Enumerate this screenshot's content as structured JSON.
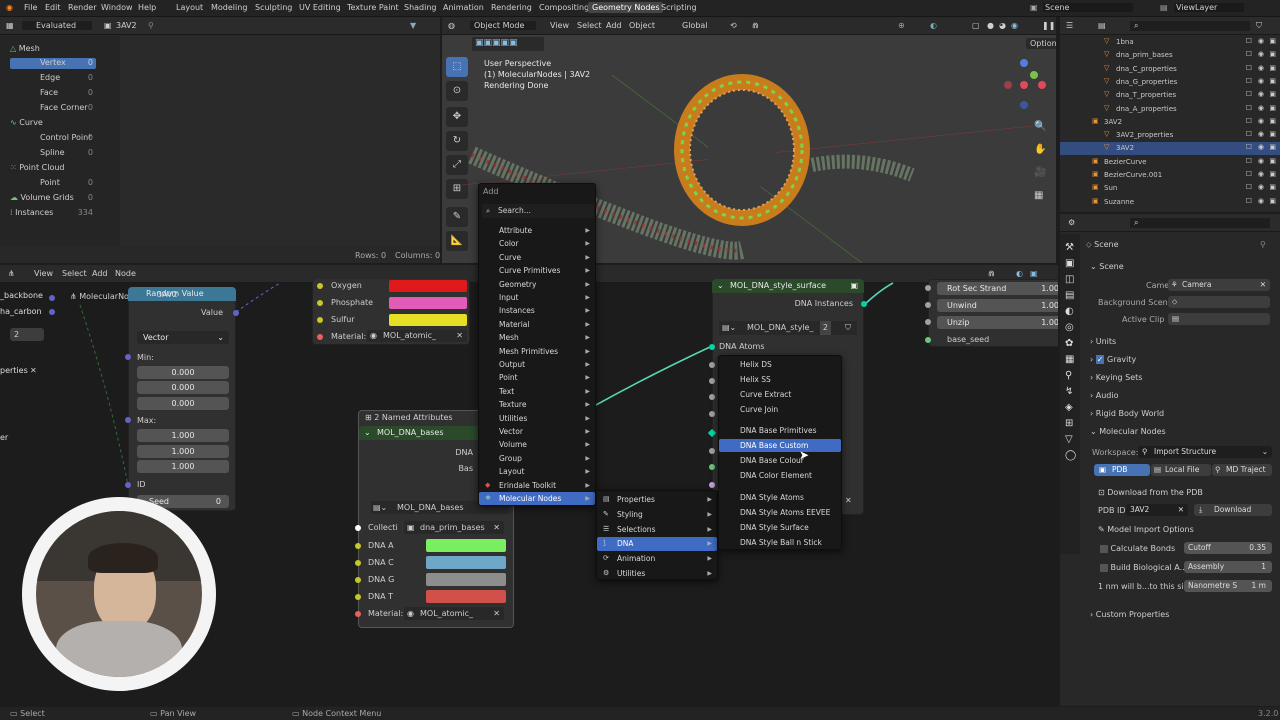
{
  "app_menu": [
    "File",
    "Edit",
    "Render",
    "Window",
    "Help"
  ],
  "workspaces": [
    "Layout",
    "Modeling",
    "Sculpting",
    "UV Editing",
    "Texture Paint",
    "Shading",
    "Animation",
    "Rendering",
    "Compositing",
    "Geometry Nodes",
    "Scripting"
  ],
  "active_workspace": "Geometry Nodes",
  "scene_name": "Scene",
  "viewlayer_name": "ViewLayer",
  "spreadsheet": {
    "mode": "Evaluated",
    "object": "3AV2",
    "domains": [
      {
        "label": "Mesh",
        "count": ""
      },
      {
        "label": "Vertex",
        "count": "0"
      },
      {
        "label": "Edge",
        "count": "0"
      },
      {
        "label": "Face",
        "count": "0"
      },
      {
        "label": "Face Corner",
        "count": "0"
      },
      {
        "label": "Curve",
        "count": ""
      },
      {
        "label": "Control Point",
        "count": "0"
      },
      {
        "label": "Spline",
        "count": "0"
      },
      {
        "label": "Point Cloud",
        "count": ""
      },
      {
        "label": "Point",
        "count": "0"
      },
      {
        "label": "Volume Grids",
        "count": "0"
      },
      {
        "label": "Instances",
        "count": "334"
      }
    ],
    "rows": "Rows: 0",
    "columns": "Columns: 0"
  },
  "viewport": {
    "mode": "Object Mode",
    "menus": [
      "View",
      "Select",
      "Add",
      "Object"
    ],
    "orientation": "Global",
    "options": "Options",
    "overlay_lines": [
      "User Perspective",
      "(1) MolecularNodes | 3AV2",
      "Rendering Done"
    ]
  },
  "node_editor": {
    "menus": [
      "View",
      "Select",
      "Add",
      "Node"
    ],
    "breadcrumb_left": "MolecularNodes",
    "breadcrumb_right": "3AV2",
    "random_value": {
      "title": "Random Value",
      "out_label": "Value",
      "type": "Vector",
      "min_label": "Min:",
      "min": [
        "0.000",
        "0.000",
        "0.000"
      ],
      "max_label": "Max:",
      "max": [
        "1.000",
        "1.000",
        "1.000"
      ],
      "id": "ID",
      "seed_label": "Seed",
      "seed": "0"
    },
    "left_partial": {
      "backbone": "_backbone",
      "carbon": "ha_carbon",
      "number": "2",
      "properties": "perties",
      "er": "er"
    },
    "atomic_node": {
      "rows": [
        {
          "label": "Oxygen",
          "color": "#e01a1a"
        },
        {
          "label": "Phosphate",
          "color": "#e35bb8"
        },
        {
          "label": "Sulfur",
          "color": "#e6df25"
        }
      ],
      "material_label": "Material:",
      "material": "MOL_atomic_"
    },
    "bases_node": {
      "frame_label": "2 Named Attributes",
      "title": "MOL_DNA_bases",
      "out1": "DNA",
      "out2": "Bas",
      "group": "MOL_DNA_bases",
      "coll_label": "Collecti",
      "coll": "dna_prim_bases",
      "rows": [
        {
          "label": "DNA A",
          "color": "#79ee60"
        },
        {
          "label": "DNA C",
          "color": "#6fa7c9"
        },
        {
          "label": "DNA G",
          "color": "#8d8d8d"
        },
        {
          "label": "DNA T",
          "color": "#d1504a"
        }
      ],
      "material_label": "Material:",
      "material": "MOL_atomic_"
    },
    "style_node": {
      "title": "MOL_DNA_style_surface",
      "out": "DNA Instances",
      "group": "MOL_DNA_style_",
      "users": "2",
      "in": "DNA Atoms"
    },
    "right_node": {
      "rows": [
        {
          "label": "Rot Sec Strand",
          "value": "1.00"
        },
        {
          "label": "Unwind",
          "value": "1.00"
        },
        {
          "label": "Unzip",
          "value": "1.00"
        }
      ],
      "last": "base_seed"
    }
  },
  "add_menu": {
    "title": "Add",
    "search": "Search...",
    "items": [
      "Attribute",
      "Color",
      "Curve",
      "Curve Primitives",
      "Geometry",
      "Input",
      "Instances",
      "Material",
      "Mesh",
      "Mesh Primitives",
      "Output",
      "Point",
      "Text",
      "Texture",
      "Utilities",
      "Vector",
      "Volume",
      "Group",
      "Layout",
      "Erindale Toolkit",
      "Molecular Nodes"
    ],
    "selected": "Molecular Nodes"
  },
  "mn_menu": {
    "items": [
      "Properties",
      "Styling",
      "Selections",
      "DNA",
      "Animation",
      "Utilities"
    ],
    "selected": "DNA"
  },
  "dna_menu": {
    "items": [
      "Helix DS",
      "Helix SS",
      "Curve Extract",
      "Curve Join",
      "DNA Base Primitives",
      "DNA Base Custom",
      "DNA Base Colour",
      "DNA Color Element",
      "DNA Style Atoms",
      "DNA Style Atoms EEVEE",
      "DNA Style Surface",
      "DNA Style Ball n Stick"
    ],
    "selected": "DNA Base Custom"
  },
  "outliner": {
    "items": [
      {
        "label": "1bna",
        "indent": 1
      },
      {
        "label": "dna_prim_bases",
        "indent": 1
      },
      {
        "label": "dna_C_properties",
        "indent": 1
      },
      {
        "label": "dna_G_properties",
        "indent": 1
      },
      {
        "label": "dna_T_properties",
        "indent": 1
      },
      {
        "label": "dna_A_properties",
        "indent": 1
      },
      {
        "label": "3AV2",
        "indent": 0
      },
      {
        "label": "3AV2_properties",
        "indent": 1
      },
      {
        "label": "3AV2",
        "indent": 1
      },
      {
        "label": "BezierCurve",
        "indent": 0
      },
      {
        "label": "BezierCurve.001",
        "indent": 0
      },
      {
        "label": "Sun",
        "indent": 0
      },
      {
        "label": "Suzanne",
        "indent": 0
      }
    ],
    "selected_index": 8
  },
  "properties": {
    "scene": "Scene",
    "section": "Scene",
    "camera_label": "Camera",
    "camera": "Camera",
    "bg_label": "Background Scene",
    "clip_label": "Active Clip",
    "sections": [
      "Units",
      "Gravity",
      "Keying Sets",
      "Audio",
      "Rigid Body World",
      "Molecular Nodes"
    ],
    "workspace_label": "Workspace:",
    "workspace": "Import Structure",
    "tabs": [
      "PDB",
      "Local File",
      "MD Traject"
    ],
    "download_header": "Download from the PDB",
    "pdb_label": "PDB ID:",
    "pdb_id": "3AV2",
    "download": "Download",
    "model_options": "Model Import Options",
    "calc_bonds": "Calculate Bonds",
    "cutoff_label": "Cutoff",
    "cutoff": "0.35",
    "build_bio": "Build Biological A...",
    "assembly_label": "Assembly",
    "assembly": "1",
    "scale_text": "1 nm will b...to this size.",
    "scale_label": "Nanometre S",
    "scale_val": "1 m",
    "custom_props": "Custom Properties"
  },
  "statusbar": {
    "items": [
      "Select",
      "Pan View",
      "Node Context Menu"
    ],
    "version": "3.2.0"
  },
  "colors": {
    "accent": "#4772b3",
    "link": "#59d6b6",
    "socket_geo": "#00d6a3",
    "socket_float": "#a1a1a1",
    "socket_vector": "#6363c7",
    "socket_color": "#c7c729",
    "socket_shader": "#ed5e5e"
  }
}
